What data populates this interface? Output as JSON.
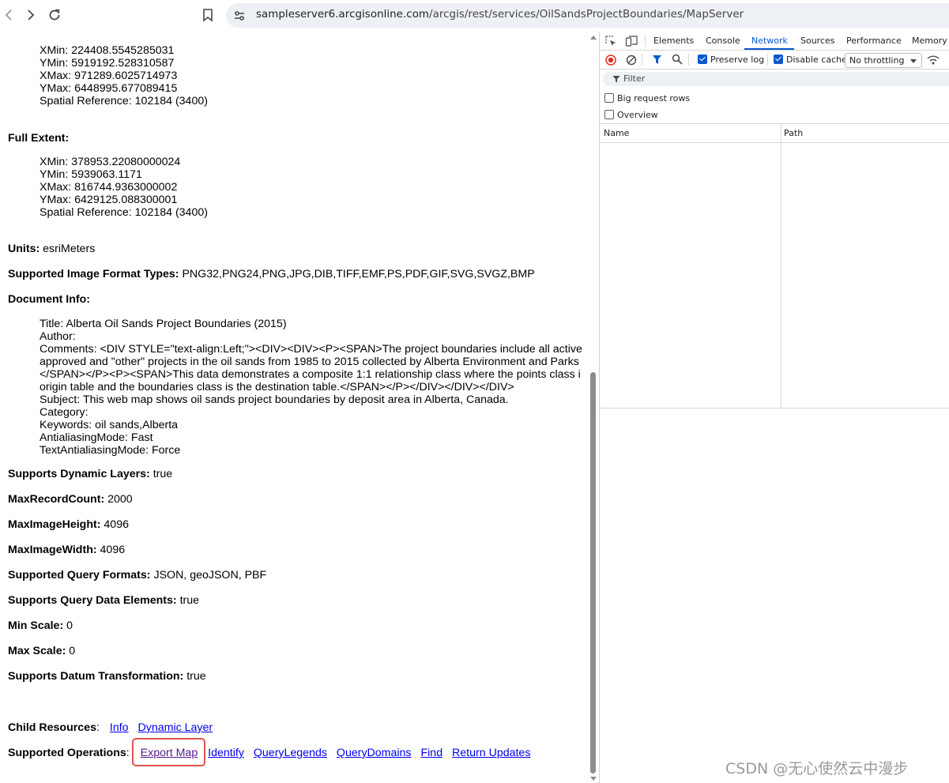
{
  "browser": {
    "url_host": "sampleserver6.arcgisonline.com",
    "url_path": "/arcgis/rest/services/OilSandsProjectBoundaries/MapServer"
  },
  "page": {
    "initial_extent": {
      "xmin": "XMin: 224408.5545285031",
      "ymin": "YMin: 5919192.528310587",
      "xmax": "XMax: 971289.6025714973",
      "ymax": "YMax: 6448995.677089415",
      "spatial_ref": "Spatial Reference: 102184  (3400)"
    },
    "full_extent": {
      "label": "Full Extent:",
      "xmin": "XMin: 378953.22080000024",
      "ymin": "YMin: 5939063.1171",
      "xmax": "XMax: 816744.9363000002",
      "ymax": "YMax: 6429125.088300001",
      "spatial_ref": "Spatial Reference: 102184  (3400)"
    },
    "units": {
      "label": "Units:",
      "value": " esriMeters"
    },
    "image_formats": {
      "label": "Supported Image Format Types:",
      "value": " PNG32,PNG24,PNG,JPG,DIB,TIFF,EMF,PS,PDF,GIF,SVG,SVGZ,BMP"
    },
    "document_info": {
      "label": "Document Info:",
      "lines": [
        "Title: Alberta Oil Sands Project Boundaries (2015)",
        "Author:",
        "Comments: <DIV STYLE=\"text-align:Left;\"><DIV><DIV><P><SPAN>The project boundaries include all active",
        "approved and \"other\" projects in the oil sands from 1985 to 2015 collected by Alberta Environment and Parks",
        "</SPAN></P><P><SPAN>This data demonstrates a composite 1:1 relationship class where the points class i",
        "origin table and the boundaries class is the destination table.</SPAN></P></DIV></DIV></DIV>",
        "Subject: This web map shows oil sands project boundaries by deposit area in Alberta, Canada.",
        "Category:",
        "Keywords: oil sands,Alberta",
        "AntialiasingMode: Fast",
        "TextAntialiasingMode: Force"
      ]
    },
    "props": [
      {
        "label": "Supports Dynamic Layers:",
        "value": " true"
      },
      {
        "label": "MaxRecordCount:",
        "value": " 2000"
      },
      {
        "label": "MaxImageHeight:",
        "value": " 4096"
      },
      {
        "label": "MaxImageWidth:",
        "value": " 4096"
      },
      {
        "label": "Supported Query Formats:",
        "value": " JSON, geoJSON, PBF"
      },
      {
        "label": "Supports Query Data Elements:",
        "value": " true"
      },
      {
        "label": "Min Scale:",
        "value": " 0"
      },
      {
        "label": "Max Scale:",
        "value": " 0"
      },
      {
        "label": "Supports Datum Transformation:",
        "value": " true"
      }
    ],
    "child_resources": {
      "label": "Child Resources",
      "colon": ":",
      "links": [
        "Info",
        "Dynamic Layer"
      ]
    },
    "supported_operations": {
      "label": "Supported Operations",
      "colon": ":",
      "links": [
        "Export Map",
        "Identify",
        "QueryLegends",
        "QueryDomains",
        "Find",
        "Return Updates"
      ]
    }
  },
  "devtools": {
    "tabs": [
      "Elements",
      "Console",
      "Network",
      "Sources",
      "Performance",
      "Memory"
    ],
    "active_tab": "Network",
    "preserve_log": "Preserve log",
    "disable_cache": "Disable cache",
    "throttling": "No throttling",
    "filter_placeholder": "Filter",
    "big_request_rows": "Big request rows",
    "overview": "Overview",
    "columns": [
      "Name",
      "Path"
    ]
  },
  "watermark": "CSDN @无心使然云中漫步",
  "colors": {
    "link": "#0000ee",
    "visited_link": "#551a8b",
    "highlight_box": "#e0544f",
    "devtools_accent": "#0b57d0"
  }
}
